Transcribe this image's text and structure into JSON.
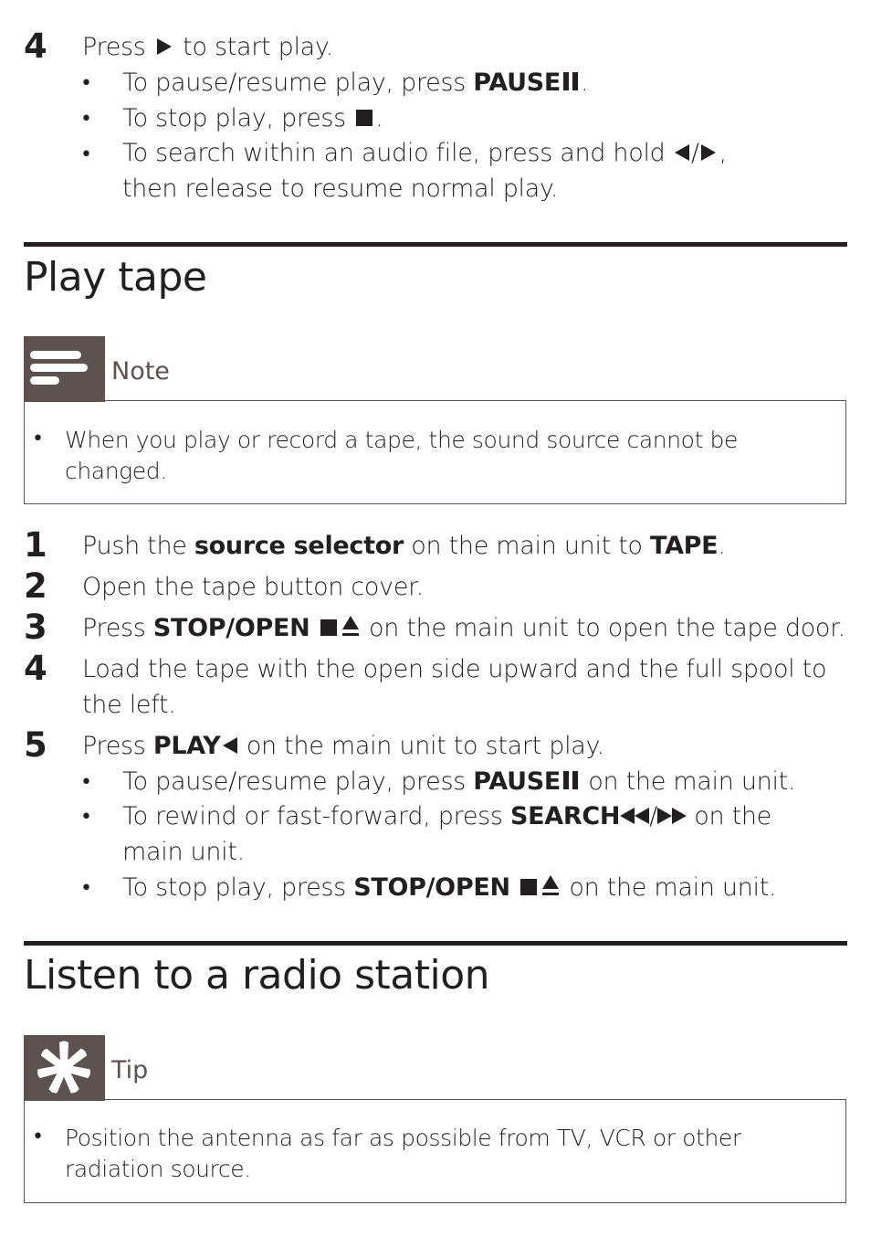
{
  "prev_step": {
    "number": "4",
    "text_before": "Press",
    "play_symbol": "play-right",
    "text_after": "to start play.",
    "bullets": [
      {
        "text": "To pause/resume play, press",
        "bold": "PAUSE",
        "symbol": "pause",
        "after": "."
      },
      {
        "text": "To stop play, press",
        "symbol": "stop",
        "after": "."
      },
      {
        "text": "To search within an audio file, press and hold",
        "symbols": "prev/next",
        "after": ",",
        "line2": "then release to resume normal play."
      }
    ]
  },
  "section_play_tape": {
    "title": "Play tape",
    "note": {
      "label": "Note",
      "icon": "note-lines-icon",
      "text_line1": "When you play or record a tape, the sound source cannot be",
      "text_line2": "changed."
    },
    "steps": [
      {
        "number": "1",
        "pre": "Push the",
        "bold1": "source selector",
        "mid": "on the main unit to",
        "bold2": "TAPE",
        "post": "."
      },
      {
        "number": "2",
        "text": "Open the tape button cover."
      },
      {
        "number": "3",
        "pre": "Press",
        "bold": "STOP/OPEN",
        "post": "on the main unit to open the tape door."
      },
      {
        "number": "4",
        "line1": "Load the tape with the open side upward and the full spool to",
        "line2": "the left."
      },
      {
        "number": "5",
        "pre": "Press",
        "bold": "PLAY",
        "post": "on the main unit to start play."
      }
    ],
    "step5_bullets": [
      {
        "pre": "To pause/resume play, press",
        "bold": "PAUSE",
        "post": "on the main unit."
      },
      {
        "pre": "To rewind or fast-forward, press",
        "bold": "SEARCH",
        "post": "on the",
        "line2": "main unit."
      },
      {
        "pre": "To stop play, press",
        "bold": "STOP/OPEN",
        "post": "on the main unit."
      }
    ]
  },
  "section_radio": {
    "title": "Listen to a radio station",
    "tip": {
      "label": "Tip",
      "icon": "tip-asterisk-icon",
      "text_line1": "Position the antenna as far as possible from TV, VCR or other",
      "text_line2": "radiation source."
    }
  }
}
